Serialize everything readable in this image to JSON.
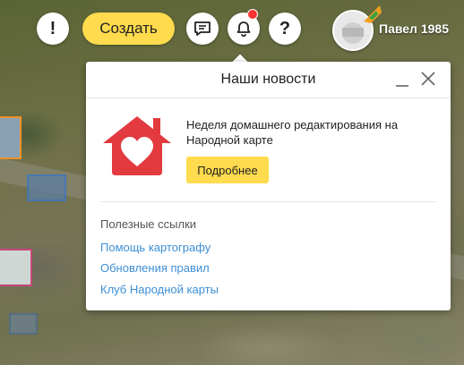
{
  "toolbar": {
    "create_label": "Создать",
    "warn_glyph": "!",
    "help_glyph": "?",
    "user_name": "Павел 1985",
    "notification_dot_color": "#ff3333"
  },
  "popup": {
    "title": "Наши новости",
    "news_text": "Неделя домашнего редактирования на Народной карте",
    "more_label": "Подробнее",
    "links_title": "Полезные ссылки",
    "links": [
      "Помощь картографу",
      "Обновления правил",
      "Клуб Народной карты"
    ]
  },
  "colors": {
    "accent_yellow": "#ffdb4d",
    "link_blue": "#3d8fd6",
    "brand_red": "#e23a3f"
  },
  "icons": [
    "warning-icon",
    "chat-icon",
    "bell-icon",
    "help-icon",
    "minimize-icon",
    "close-icon",
    "home-heart-icon",
    "user-badge-icon"
  ]
}
